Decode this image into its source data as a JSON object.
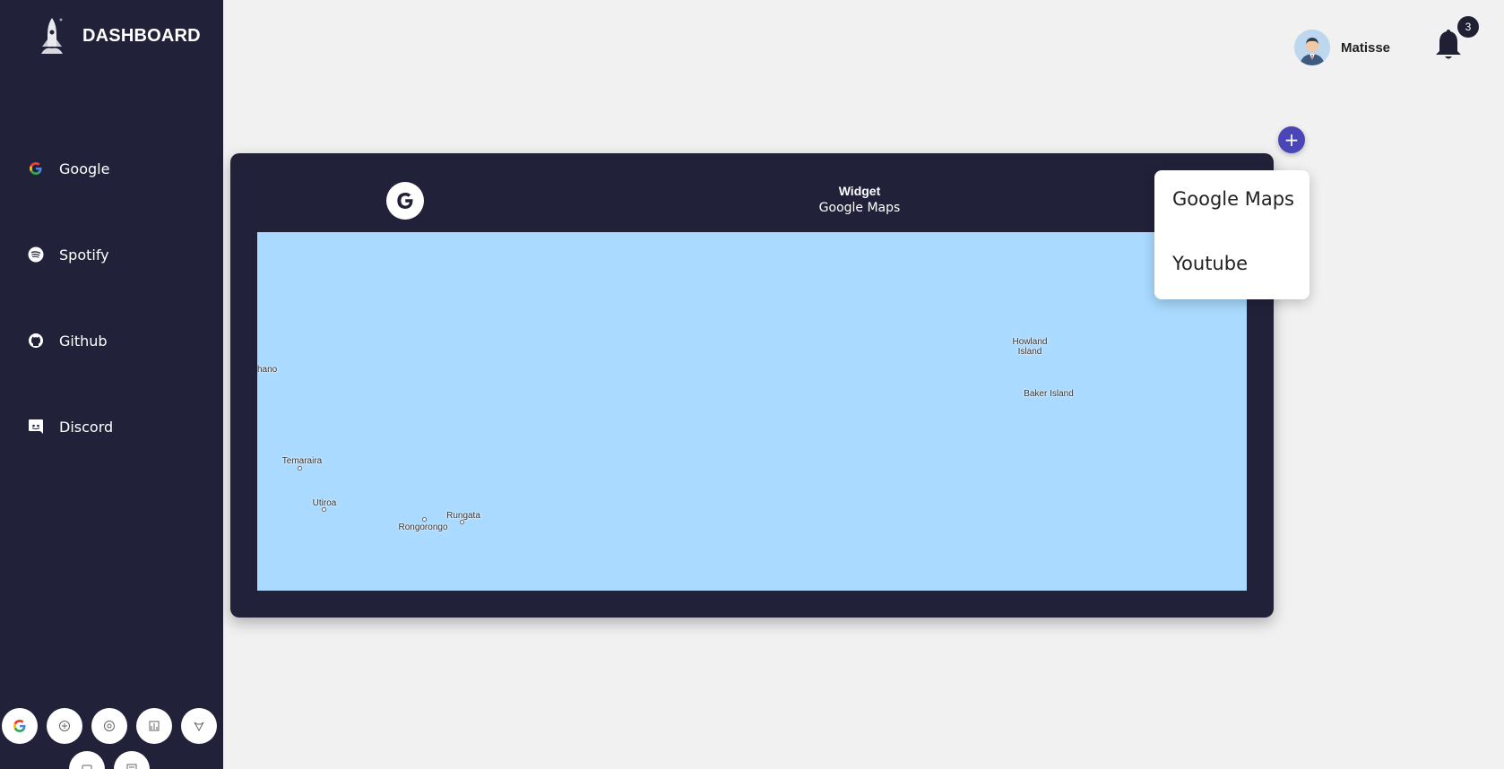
{
  "sidebar": {
    "brand": "DASHBOARD",
    "items": [
      {
        "label": "Google",
        "icon": "google-icon"
      },
      {
        "label": "Spotify",
        "icon": "spotify-icon"
      },
      {
        "label": "Github",
        "icon": "github-icon"
      },
      {
        "label": "Discord",
        "icon": "discord-icon"
      }
    ],
    "service_buttons": [
      {
        "icon": "google-icon",
        "glyph": "G"
      },
      {
        "icon": "service-icon-2",
        "glyph": ""
      },
      {
        "icon": "service-icon-3",
        "glyph": ""
      },
      {
        "icon": "service-icon-4",
        "glyph": ""
      },
      {
        "icon": "service-icon-5",
        "glyph": ""
      },
      {
        "icon": "service-icon-6",
        "glyph": ""
      },
      {
        "icon": "service-icon-7",
        "glyph": ""
      }
    ]
  },
  "header": {
    "user_name": "Matisse",
    "notification_count": "3"
  },
  "widget": {
    "title": "Widget",
    "subtitle": "Google Maps",
    "map_labels": [
      {
        "text": "Howland\nIsland"
      },
      {
        "text": "Baker Island"
      },
      {
        "text": "hano"
      },
      {
        "text": "Temaraira"
      },
      {
        "text": "Utiroa"
      },
      {
        "text": "Rungata"
      },
      {
        "text": "Rongorongo"
      }
    ],
    "map_color": "#aadaff"
  },
  "add_menu": {
    "items": [
      "Google Maps",
      "Youtube"
    ]
  },
  "colors": {
    "sidebar_bg": "#21223a",
    "accent": "#4a46b8",
    "page_bg": "#f1f1f1"
  }
}
